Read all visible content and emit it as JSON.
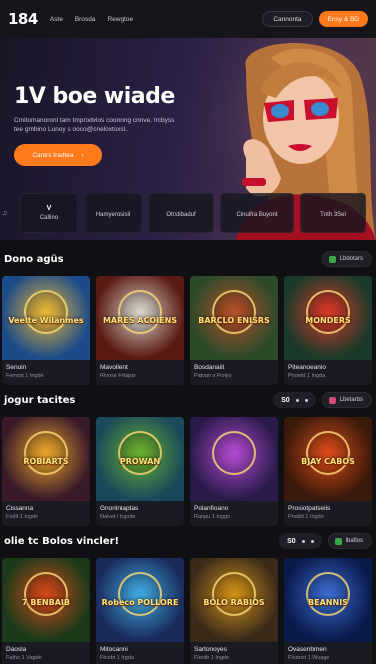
{
  "header": {
    "logo": "184",
    "nav": [
      "Aste",
      "Brosda",
      "Rewgtoe"
    ],
    "login_label": "Cannonta",
    "signup_label": "Ensy & BD"
  },
  "hero": {
    "title": "1V boe wiade",
    "subtitle": "Cmitomanoronl tam tmprodvlos coonnng cnnve. Ircbyss tee gmbino Lunoy s ooco@cneloxtsxsl..",
    "cta_label": "Cantrs tradtea",
    "cta_arrow": "›"
  },
  "stats": [
    {
      "top": "V",
      "bottom": "Callino"
    },
    {
      "top": "",
      "bottom": "Hamyerosisil"
    },
    {
      "top": "",
      "bottom": "Otrstibaduf"
    },
    {
      "top": "",
      "bottom": "Cinuifra Buyont"
    },
    {
      "top": "",
      "bottom": "Tnth 3Sel"
    }
  ],
  "section1": {
    "title": "Dono agüs",
    "view_all": "Lbdotars",
    "cards": [
      {
        "label": "Veelte Wilanmes",
        "name": "Senuin",
        "provider": "Fenvist 1 Ingde",
        "bg": "#1c4b8a",
        "bg2": "#e8b83a"
      },
      {
        "label": "MARES ACOIENS",
        "name": "Mavollent",
        "provider": "Rlvose Frtapsr",
        "bg": "#5a1a14",
        "bg2": "#d8d2c8"
      },
      {
        "label": "BARCLO ENISRS",
        "name": "Bosdanaiit",
        "provider": "Patvan s Fiolyo",
        "bg": "#2a4a2a",
        "bg2": "#b5522a"
      },
      {
        "label": "MONDERS",
        "name": "Piteanoeanio",
        "provider": "Pnoetd 1 Ingda",
        "bg": "#1a3a2a",
        "bg2": "#d33a2a"
      }
    ]
  },
  "section2": {
    "title": "jogur tacites",
    "count": "S0",
    "view_all": "Lbetarbs",
    "cards": [
      {
        "label": "ROBIARTS",
        "name": "Cissanna",
        "provider": "Fodlt 1 Ingde",
        "bg": "#3a1a2a",
        "bg2": "#e8a22a"
      },
      {
        "label": "PROWAN",
        "name": "Gnonlnlaptas",
        "provider": "Nalvet i Irgode",
        "bg": "#1a4a5a",
        "bg2": "#6ab030"
      },
      {
        "label": "",
        "name": "Polanfioano",
        "provider": "Ranpu 1 Inggo",
        "bg": "#2a1a4a",
        "bg2": "#b04ad0"
      },
      {
        "label": "BJAY CABOS",
        "name": "Prosiotpatseiis",
        "provider": "Pnatbt 1 Ingdo",
        "bg": "#3a1a0a",
        "bg2": "#d84a1a"
      }
    ]
  },
  "section3": {
    "title": "olie tc Bolos vincler!",
    "count": "S0",
    "view_all": "lbaflos",
    "cards": [
      {
        "label": "7 BENBAIB",
        "name": "Daosla",
        "provider": "Fatho 1 Vagde",
        "bg": "#1a3a1a",
        "bg2": "#d04a1a"
      },
      {
        "label": "Robeco POLLORE",
        "name": "Mitocanni",
        "provider": "Ftcobt 1 Irgda",
        "bg": "#1a2a5a",
        "bg2": "#40a8e0"
      },
      {
        "label": "BOLO RABIOS",
        "name": "Sartonoyes",
        "provider": "Fleotb 1 Ingde",
        "bg": "#3a2a1a",
        "bg2": "#d0901a"
      },
      {
        "label": "BEANNIS",
        "name": "Ovasenbmen",
        "provider": "Floanct 1 Wuage",
        "bg": "#0a1a4a",
        "bg2": "#3a6ad0"
      }
    ]
  },
  "colors": {
    "accent": "#ff7a1a",
    "bg": "#0f0f14"
  }
}
